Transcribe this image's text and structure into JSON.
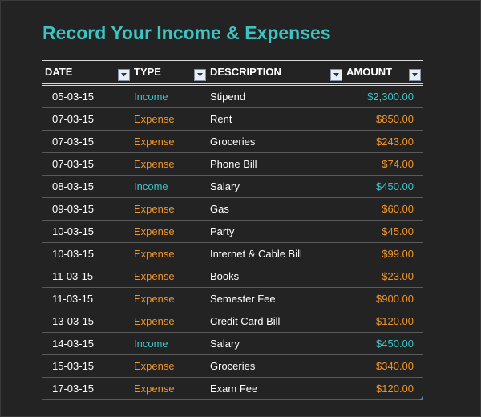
{
  "title": "Record Your Income & Expenses",
  "colors": {
    "title": "#3ec3c3",
    "income": "#3ec3c3",
    "expense": "#f0932b",
    "background": "#222222"
  },
  "table": {
    "headers": [
      "DATE",
      "TYPE",
      "DESCRIPTION",
      "AMOUNT"
    ],
    "filter_icon": "dropdown-arrow-icon",
    "rows": [
      {
        "date": "05-03-15",
        "type": "Income",
        "description": "Stipend",
        "amount": "$2,300.00"
      },
      {
        "date": "07-03-15",
        "type": "Expense",
        "description": "Rent",
        "amount": "$850.00"
      },
      {
        "date": "07-03-15",
        "type": "Expense",
        "description": "Groceries",
        "amount": "$243.00"
      },
      {
        "date": "07-03-15",
        "type": "Expense",
        "description": "Phone Bill",
        "amount": "$74.00"
      },
      {
        "date": "08-03-15",
        "type": "Income",
        "description": "Salary",
        "amount": "$450.00"
      },
      {
        "date": "09-03-15",
        "type": "Expense",
        "description": "Gas",
        "amount": "$60.00"
      },
      {
        "date": "10-03-15",
        "type": "Expense",
        "description": "Party",
        "amount": "$45.00"
      },
      {
        "date": "10-03-15",
        "type": "Expense",
        "description": "Internet & Cable Bill",
        "amount": "$99.00"
      },
      {
        "date": "11-03-15",
        "type": "Expense",
        "description": "Books",
        "amount": "$23.00"
      },
      {
        "date": "11-03-15",
        "type": "Expense",
        "description": "Semester Fee",
        "amount": "$900.00"
      },
      {
        "date": "13-03-15",
        "type": "Expense",
        "description": "Credit Card Bill",
        "amount": "$120.00"
      },
      {
        "date": "14-03-15",
        "type": "Income",
        "description": "Salary",
        "amount": "$450.00"
      },
      {
        "date": "15-03-15",
        "type": "Expense",
        "description": "Groceries",
        "amount": "$340.00"
      },
      {
        "date": "17-03-15",
        "type": "Expense",
        "description": "Exam Fee",
        "amount": "$120.00"
      }
    ]
  }
}
